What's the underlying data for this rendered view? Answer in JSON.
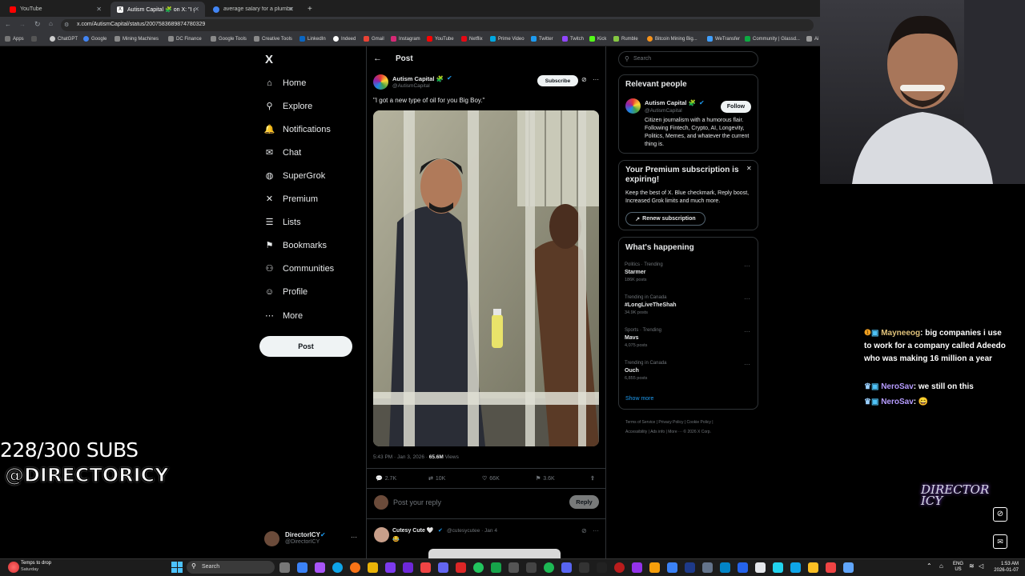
{
  "browser": {
    "tabs": [
      {
        "title": "YouTube",
        "color": "#ff0000"
      },
      {
        "title": "Autism Capital 🧩 on X: \"I got",
        "color": "#ffffff"
      },
      {
        "title": "average salary for a plumber an",
        "color": "#4285f4"
      }
    ],
    "new_tab": "+",
    "url": "x.com/AutismCapital/status/2007583689874780329",
    "bookmarks": [
      "Apps",
      "ChatGPT",
      "Google",
      "Mining Machines",
      "DC Finance",
      "Google Tools",
      "Creative Tools",
      "LinkedIn",
      "Indeed",
      "Gmail",
      "Instagram",
      "YouTube",
      "Netflix",
      "Prime Video",
      "Twitter",
      "Twitch",
      "Kick",
      "Rumble",
      "Bitcoin Mining Big...",
      "WeTransfer",
      "Community | Glassd...",
      "Ai"
    ]
  },
  "sidebar": {
    "logo": "X",
    "items": [
      {
        "label": "Home",
        "icon": "home-icon",
        "glyph": "⌂"
      },
      {
        "label": "Explore",
        "icon": "search-icon",
        "glyph": "⚲"
      },
      {
        "label": "Notifications",
        "icon": "bell-icon",
        "glyph": "🔔"
      },
      {
        "label": "Chat",
        "icon": "mail-icon",
        "glyph": "✉"
      },
      {
        "label": "SuperGrok",
        "icon": "grok-icon",
        "glyph": "◍"
      },
      {
        "label": "Premium",
        "icon": "x-premium-icon",
        "glyph": "✕"
      },
      {
        "label": "Lists",
        "icon": "list-icon",
        "glyph": "☰"
      },
      {
        "label": "Bookmarks",
        "icon": "bookmark-icon",
        "glyph": "⚑"
      },
      {
        "label": "Communities",
        "icon": "people-icon",
        "glyph": "⚇"
      },
      {
        "label": "Profile",
        "icon": "person-icon",
        "glyph": "☺"
      },
      {
        "label": "More",
        "icon": "more-circle-icon",
        "glyph": "⋯"
      }
    ],
    "post_button": "Post",
    "account": {
      "name": "DirectorICY",
      "handle": "@DirectorICY",
      "more": "···"
    }
  },
  "post": {
    "header": "Post",
    "author": "Autism Capital 🧩",
    "handle": "@AutismCapital",
    "subscribe": "Subscribe",
    "text": "\"I got a new type of oil for you Big Boy.\"",
    "time": "5:43 PM · Jan 3, 2026 · ",
    "views_count": "65.6M",
    "views_label": " Views",
    "replies": "2.7K",
    "reposts": "10K",
    "likes": "66K",
    "bookmarks": "3.6K",
    "reply_placeholder": "Post your reply",
    "reply_button": "Reply"
  },
  "reply": {
    "author": "Cutesy Cute 🤍",
    "handle": "@cutesycutee · Jan 4",
    "text": "😂"
  },
  "right": {
    "search_placeholder": "Search",
    "relevant_title": "Relevant people",
    "person": {
      "name": "Autism Capital 🧩",
      "handle": "@AutismCapital",
      "follow": "Follow",
      "bio": "Citizen journalism with a humorous flair. Following Fintech, Crypto, AI, Longevity, Politics, Memes, and whatever the current thing is."
    },
    "premium": {
      "title": "Your Premium subscription is expiring!",
      "body": "Keep the best of X. Blue checkmark, Reply boost, Increased Grok limits and much more.",
      "button": "Renew subscription",
      "close": "✕"
    },
    "happening_title": "What's happening",
    "trends": [
      {
        "category": "Politics · Trending",
        "name": "Starmer",
        "count": "186K posts"
      },
      {
        "category": "Trending in Canada",
        "name": "#LongLiveTheShah",
        "count": "34.9K posts"
      },
      {
        "category": "Sports · Trending",
        "name": "Mavs",
        "count": "4,075 posts"
      },
      {
        "category": "Trending in Canada",
        "name": "Ouch",
        "count": "6,855 posts"
      }
    ],
    "show_more": "Show more",
    "footer": [
      "Terms of Service",
      "|",
      "Privacy Policy",
      "|",
      "Cookie Policy",
      "|",
      "Accessibility",
      "|",
      "Ads info",
      "|",
      "More ···",
      "© 2026 X Corp."
    ]
  },
  "overlay": {
    "subs": "228/300 SUBS",
    "handle": "@DIRECTORICY",
    "chat": [
      {
        "user": "Mayneeog",
        "msg": ": big companies i use to work for a company called Adeedo who was making 16 million a year"
      },
      {
        "user": "NeroSav",
        "msg": ": we still on this"
      },
      {
        "user": "NeroSav",
        "msg": ": 😄"
      }
    ],
    "logo": "DIRECTOR ICY"
  },
  "taskbar": {
    "weather_title": "Temps to drop",
    "weather_sub": "Saturday",
    "search": "Search",
    "lang": "ENG",
    "region": "US",
    "time": "1:53 AM",
    "date": "2026-01-07"
  }
}
